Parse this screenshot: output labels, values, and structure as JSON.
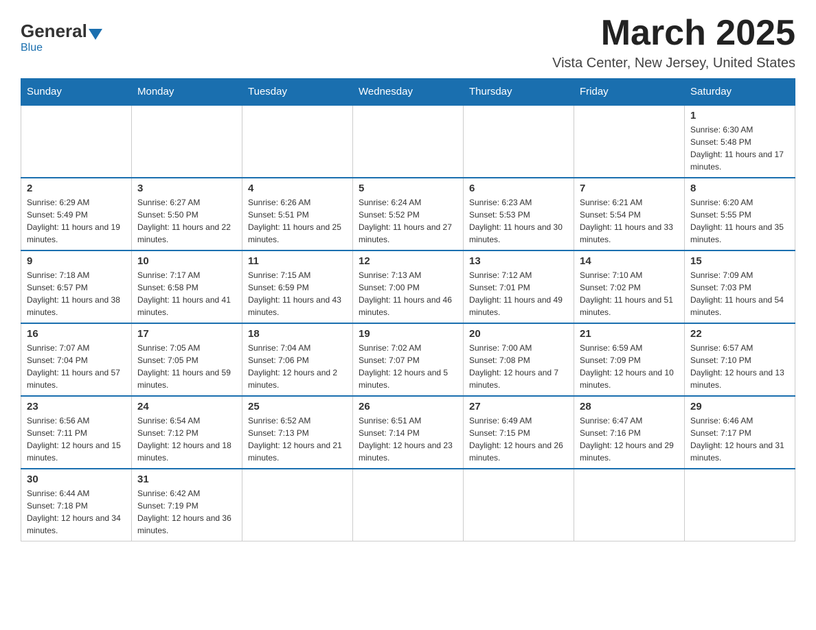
{
  "logo": {
    "general": "General",
    "blue": "Blue"
  },
  "title": "March 2025",
  "location": "Vista Center, New Jersey, United States",
  "days_of_week": [
    "Sunday",
    "Monday",
    "Tuesday",
    "Wednesday",
    "Thursday",
    "Friday",
    "Saturday"
  ],
  "weeks": [
    [
      {
        "day": null,
        "info": null
      },
      {
        "day": null,
        "info": null
      },
      {
        "day": null,
        "info": null
      },
      {
        "day": null,
        "info": null
      },
      {
        "day": null,
        "info": null
      },
      {
        "day": null,
        "info": null
      },
      {
        "day": "1",
        "info": "Sunrise: 6:30 AM\nSunset: 5:48 PM\nDaylight: 11 hours and 17 minutes."
      }
    ],
    [
      {
        "day": "2",
        "info": "Sunrise: 6:29 AM\nSunset: 5:49 PM\nDaylight: 11 hours and 19 minutes."
      },
      {
        "day": "3",
        "info": "Sunrise: 6:27 AM\nSunset: 5:50 PM\nDaylight: 11 hours and 22 minutes."
      },
      {
        "day": "4",
        "info": "Sunrise: 6:26 AM\nSunset: 5:51 PM\nDaylight: 11 hours and 25 minutes."
      },
      {
        "day": "5",
        "info": "Sunrise: 6:24 AM\nSunset: 5:52 PM\nDaylight: 11 hours and 27 minutes."
      },
      {
        "day": "6",
        "info": "Sunrise: 6:23 AM\nSunset: 5:53 PM\nDaylight: 11 hours and 30 minutes."
      },
      {
        "day": "7",
        "info": "Sunrise: 6:21 AM\nSunset: 5:54 PM\nDaylight: 11 hours and 33 minutes."
      },
      {
        "day": "8",
        "info": "Sunrise: 6:20 AM\nSunset: 5:55 PM\nDaylight: 11 hours and 35 minutes."
      }
    ],
    [
      {
        "day": "9",
        "info": "Sunrise: 7:18 AM\nSunset: 6:57 PM\nDaylight: 11 hours and 38 minutes."
      },
      {
        "day": "10",
        "info": "Sunrise: 7:17 AM\nSunset: 6:58 PM\nDaylight: 11 hours and 41 minutes."
      },
      {
        "day": "11",
        "info": "Sunrise: 7:15 AM\nSunset: 6:59 PM\nDaylight: 11 hours and 43 minutes."
      },
      {
        "day": "12",
        "info": "Sunrise: 7:13 AM\nSunset: 7:00 PM\nDaylight: 11 hours and 46 minutes."
      },
      {
        "day": "13",
        "info": "Sunrise: 7:12 AM\nSunset: 7:01 PM\nDaylight: 11 hours and 49 minutes."
      },
      {
        "day": "14",
        "info": "Sunrise: 7:10 AM\nSunset: 7:02 PM\nDaylight: 11 hours and 51 minutes."
      },
      {
        "day": "15",
        "info": "Sunrise: 7:09 AM\nSunset: 7:03 PM\nDaylight: 11 hours and 54 minutes."
      }
    ],
    [
      {
        "day": "16",
        "info": "Sunrise: 7:07 AM\nSunset: 7:04 PM\nDaylight: 11 hours and 57 minutes."
      },
      {
        "day": "17",
        "info": "Sunrise: 7:05 AM\nSunset: 7:05 PM\nDaylight: 11 hours and 59 minutes."
      },
      {
        "day": "18",
        "info": "Sunrise: 7:04 AM\nSunset: 7:06 PM\nDaylight: 12 hours and 2 minutes."
      },
      {
        "day": "19",
        "info": "Sunrise: 7:02 AM\nSunset: 7:07 PM\nDaylight: 12 hours and 5 minutes."
      },
      {
        "day": "20",
        "info": "Sunrise: 7:00 AM\nSunset: 7:08 PM\nDaylight: 12 hours and 7 minutes."
      },
      {
        "day": "21",
        "info": "Sunrise: 6:59 AM\nSunset: 7:09 PM\nDaylight: 12 hours and 10 minutes."
      },
      {
        "day": "22",
        "info": "Sunrise: 6:57 AM\nSunset: 7:10 PM\nDaylight: 12 hours and 13 minutes."
      }
    ],
    [
      {
        "day": "23",
        "info": "Sunrise: 6:56 AM\nSunset: 7:11 PM\nDaylight: 12 hours and 15 minutes."
      },
      {
        "day": "24",
        "info": "Sunrise: 6:54 AM\nSunset: 7:12 PM\nDaylight: 12 hours and 18 minutes."
      },
      {
        "day": "25",
        "info": "Sunrise: 6:52 AM\nSunset: 7:13 PM\nDaylight: 12 hours and 21 minutes."
      },
      {
        "day": "26",
        "info": "Sunrise: 6:51 AM\nSunset: 7:14 PM\nDaylight: 12 hours and 23 minutes."
      },
      {
        "day": "27",
        "info": "Sunrise: 6:49 AM\nSunset: 7:15 PM\nDaylight: 12 hours and 26 minutes."
      },
      {
        "day": "28",
        "info": "Sunrise: 6:47 AM\nSunset: 7:16 PM\nDaylight: 12 hours and 29 minutes."
      },
      {
        "day": "29",
        "info": "Sunrise: 6:46 AM\nSunset: 7:17 PM\nDaylight: 12 hours and 31 minutes."
      }
    ],
    [
      {
        "day": "30",
        "info": "Sunrise: 6:44 AM\nSunset: 7:18 PM\nDaylight: 12 hours and 34 minutes."
      },
      {
        "day": "31",
        "info": "Sunrise: 6:42 AM\nSunset: 7:19 PM\nDaylight: 12 hours and 36 minutes."
      },
      {
        "day": null,
        "info": null
      },
      {
        "day": null,
        "info": null
      },
      {
        "day": null,
        "info": null
      },
      {
        "day": null,
        "info": null
      },
      {
        "day": null,
        "info": null
      }
    ]
  ]
}
